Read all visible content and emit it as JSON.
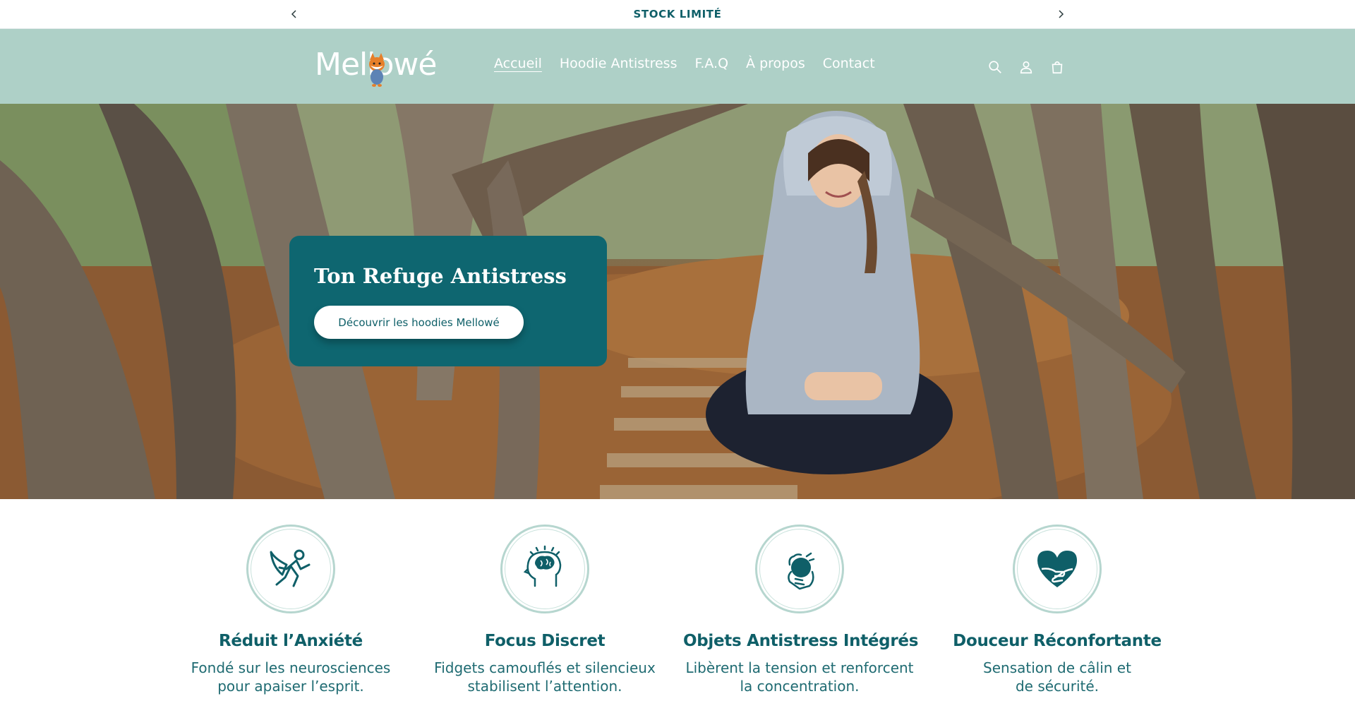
{
  "announcement": {
    "message": "STOCK LIMITÉ",
    "prev_icon": "chevron-left-icon",
    "next_icon": "chevron-right-icon"
  },
  "header": {
    "logo_text": "Mellowé",
    "nav": [
      {
        "label": "Accueil",
        "active": true
      },
      {
        "label": "Hoodie Antistress",
        "active": false
      },
      {
        "label": "F.A.Q",
        "active": false
      },
      {
        "label": "À propos",
        "active": false
      },
      {
        "label": "Contact",
        "active": false
      }
    ],
    "icons": [
      "search-icon",
      "account-icon",
      "cart-icon"
    ],
    "background": "#aed0c7"
  },
  "hero": {
    "title": "Ton Refuge Antistress",
    "button_label": "Découvrir les hoodies Mellowé",
    "card_color": "#0e6670"
  },
  "features": [
    {
      "icon": "superhero-icon",
      "title": "Réduit l’Anxiété",
      "line1": "Fondé sur les neurosciences",
      "line2": "pour apaiser l’esprit."
    },
    {
      "icon": "brain-head-icon",
      "title": "Focus Discret",
      "line1": "Fidgets camouflés et silencieux",
      "line2": "stabilisent l’attention."
    },
    {
      "icon": "squeeze-ball-icon",
      "title": "Objets Antistress Intégrés",
      "line1": "Libèrent la tension et renforcent",
      "line2": "la concentration."
    },
    {
      "icon": "heart-hug-icon",
      "title": "Douceur Réconfortante",
      "line1": "Sensation de câlin et",
      "line2": "de sécurité."
    }
  ],
  "colors": {
    "brand_teal": "#0f5f68",
    "accent_mint": "#aed0c7"
  }
}
